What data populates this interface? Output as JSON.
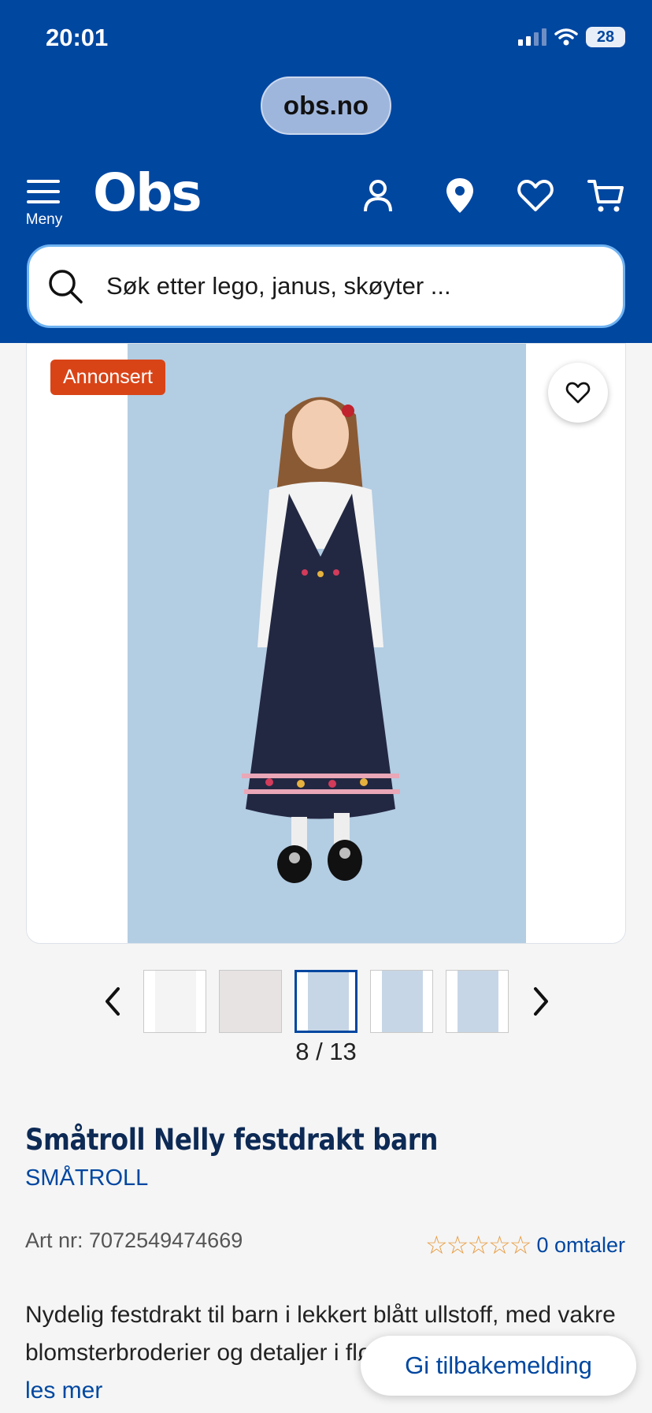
{
  "status_bar": {
    "time": "20:01",
    "battery": "28"
  },
  "browser": {
    "url": "obs.no"
  },
  "header": {
    "menu_label": "Meny",
    "logo": "Obs",
    "accent": "#0047a0"
  },
  "search": {
    "placeholder": "Søk etter lego, janus, skøyter ..."
  },
  "gallery": {
    "badge": "Annonsert",
    "counter": "8 / 13",
    "current_index": 8,
    "total": 13
  },
  "product": {
    "title": "Småtroll Nelly festdrakt barn",
    "brand": "SMÅTROLL",
    "art_nr": "Art nr: 7072549474669",
    "stars": "☆☆☆☆☆",
    "rating": 0,
    "reviews": "0 omtaler",
    "description": "Nydelig festdrakt til barn i lekkert blått ullstoff, med vakre blomsterbroderier og detaljer i fløyel. Medfølgende belt…",
    "read_more": "les mer"
  },
  "feedback": {
    "label": "Gi tilbakemelding"
  }
}
